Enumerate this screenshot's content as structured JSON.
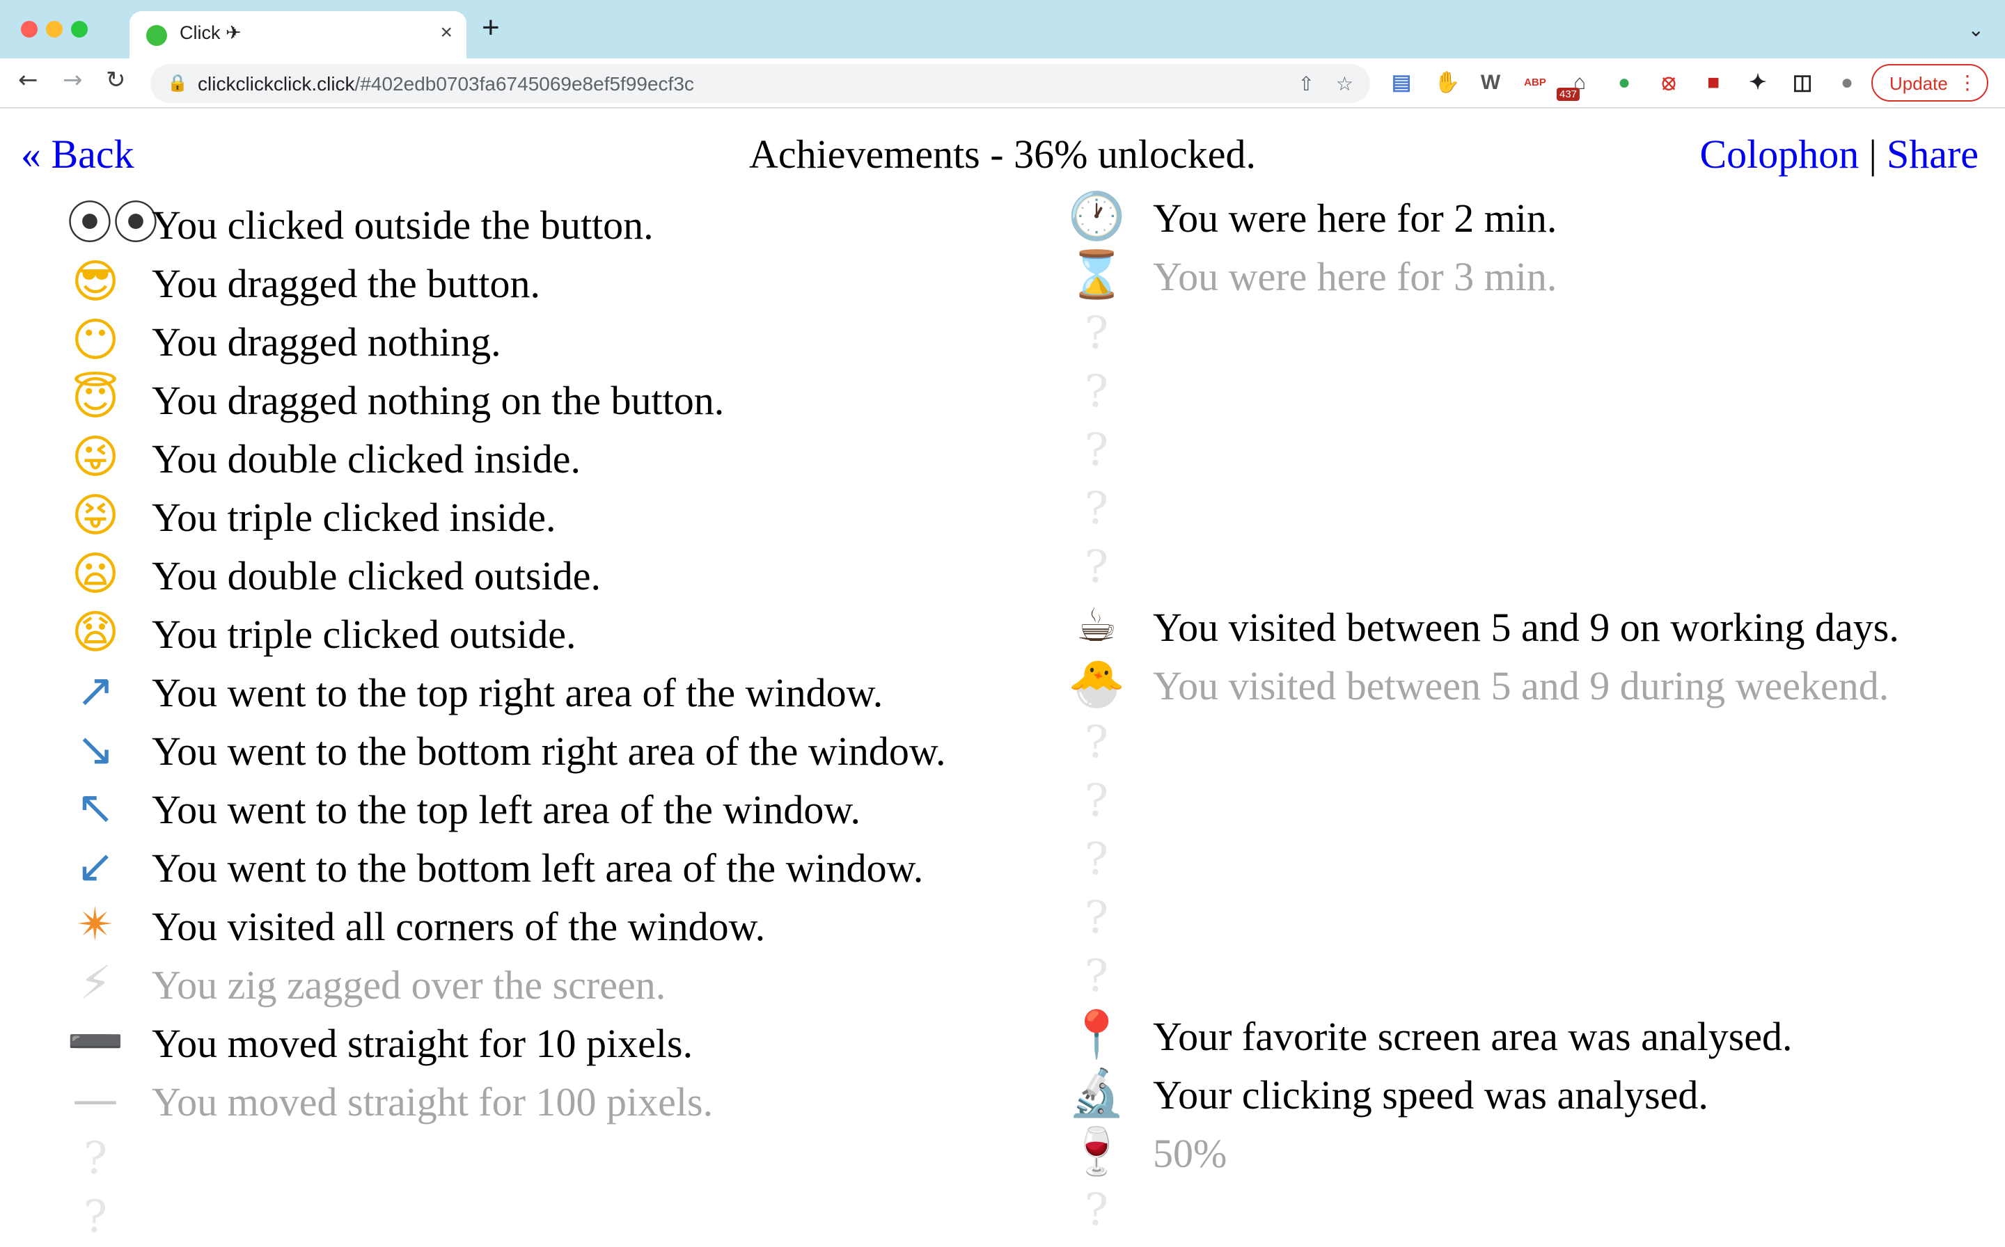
{
  "browser": {
    "tab_title": "Click ✈",
    "tab_close": "×",
    "new_tab": "+",
    "tab_menu": "⌄",
    "url_domain": "clickclickclick.click",
    "url_rest": "/#402edb0703fa6745069e8ef5f99ecf3c",
    "ext_badge": "437",
    "update_label": "Update",
    "update_menu": "⋮",
    "extensions": [
      {
        "name": "docs-ext-icon",
        "glyph": "▤",
        "color": "#4a7bd8"
      },
      {
        "name": "thumbs-up-ext-icon",
        "glyph": "✋",
        "color": "#e6a817"
      },
      {
        "name": "wallet-ext-icon",
        "glyph": "W",
        "color": "#555555"
      },
      {
        "name": "adblock-ext-icon",
        "glyph": "ABP",
        "color": "#d93025"
      },
      {
        "name": "museum-ext-icon",
        "glyph": "⌂",
        "color": "#444444"
      },
      {
        "name": "green-ext-icon",
        "glyph": "●",
        "color": "#34a853"
      },
      {
        "name": "block-ext-icon",
        "glyph": "⦻",
        "color": "#d93025"
      },
      {
        "name": "red-ext-icon",
        "glyph": "■",
        "color": "#c5221f"
      },
      {
        "name": "puzzle-ext-icon",
        "glyph": "✦",
        "color": "#202124"
      },
      {
        "name": "sidepanel-ext-icon",
        "glyph": "◫",
        "color": "#202124"
      },
      {
        "name": "profile-avatar-icon",
        "glyph": "●",
        "color": "#7d7d7d"
      }
    ]
  },
  "page": {
    "back_label": "« Back",
    "title": "Achievements - 36% unlocked.",
    "colophon_label": "Colophon",
    "separator": "|",
    "share_label": "Share"
  },
  "left_achievements": [
    {
      "icon": "eyeglasses-icon",
      "glyph": "⦿⦿",
      "color": "#333333",
      "label": "You clicked outside the button.",
      "unlocked": true
    },
    {
      "icon": "cool-face-icon",
      "glyph": "😎",
      "color": "#f4b400",
      "label": "You dragged the button.",
      "unlocked": true
    },
    {
      "icon": "no-mouth-face-icon",
      "glyph": "😶",
      "color": "#f4b400",
      "label": "You dragged nothing.",
      "unlocked": true
    },
    {
      "icon": "halo-face-icon",
      "glyph": "😇",
      "color": "#f4b400",
      "label": "You dragged nothing on the button.",
      "unlocked": true
    },
    {
      "icon": "winking-tongue-face-icon",
      "glyph": "😜",
      "color": "#f4b400",
      "label": "You double clicked inside.",
      "unlocked": true
    },
    {
      "icon": "squinting-tongue-face-icon",
      "glyph": "😝",
      "color": "#f4b400",
      "label": "You triple clicked inside.",
      "unlocked": true
    },
    {
      "icon": "frowning-face-icon",
      "glyph": "😦",
      "color": "#f4b400",
      "label": "You double clicked outside.",
      "unlocked": true
    },
    {
      "icon": "worried-face-icon",
      "glyph": "😧",
      "color": "#f4b400",
      "label": "You triple clicked outside.",
      "unlocked": true
    },
    {
      "icon": "arrow-up-right-icon",
      "glyph": "↗",
      "color": "#3b82c4",
      "label": "You went to the top right area of the window.",
      "unlocked": true
    },
    {
      "icon": "arrow-down-right-icon",
      "glyph": "↘",
      "color": "#3b82c4",
      "label": "You went to the bottom right area of the window.",
      "unlocked": true
    },
    {
      "icon": "arrow-up-left-icon",
      "glyph": "↖",
      "color": "#3b82c4",
      "label": "You went to the top left area of the window.",
      "unlocked": true
    },
    {
      "icon": "arrow-down-left-icon",
      "glyph": "↙",
      "color": "#3b82c4",
      "label": "You went to the bottom left area of the window.",
      "unlocked": true
    },
    {
      "icon": "eight-pointed-star-icon",
      "glyph": "✴",
      "color": "#f28c28",
      "label": "You visited all corners of the window.",
      "unlocked": true
    },
    {
      "icon": "lightning-icon",
      "glyph": "⚡",
      "color": "#d9d9d9",
      "label": "You zig zagged over the screen.",
      "unlocked": false
    },
    {
      "icon": "heavy-minus-icon",
      "glyph": "➖",
      "color": "#333333",
      "label": "You moved straight for 10 pixels.",
      "unlocked": true
    },
    {
      "icon": "horizontal-line-icon",
      "glyph": "—",
      "color": "#c8c8c8",
      "label": "You moved straight for 100 pixels.",
      "unlocked": false
    },
    {
      "icon": "question-mark-icon",
      "glyph": "?",
      "color": "#e6e6e6",
      "label": "",
      "unlocked": false
    },
    {
      "icon": "question-mark-icon",
      "glyph": "?",
      "color": "#e6e6e6",
      "label": "",
      "unlocked": false
    }
  ],
  "right_achievements": [
    {
      "icon": "clock-icon",
      "glyph": "🕐",
      "color": "#777777",
      "label": "You were here for 2 min.",
      "unlocked": true
    },
    {
      "icon": "hourglass-icon",
      "glyph": "⌛",
      "color": "#d9d2c4",
      "label": "You were here for 3 min.",
      "unlocked": false
    },
    {
      "icon": "question-mark-icon",
      "glyph": "?",
      "color": "#e6e6e6",
      "label": "",
      "unlocked": false
    },
    {
      "icon": "question-mark-icon",
      "glyph": "?",
      "color": "#e6e6e6",
      "label": "",
      "unlocked": false
    },
    {
      "icon": "question-mark-icon",
      "glyph": "?",
      "color": "#e6e6e6",
      "label": "",
      "unlocked": false
    },
    {
      "icon": "question-mark-icon",
      "glyph": "?",
      "color": "#e6e6e6",
      "label": "",
      "unlocked": false
    },
    {
      "icon": "question-mark-icon",
      "glyph": "?",
      "color": "#e6e6e6",
      "label": "",
      "unlocked": false
    },
    {
      "icon": "coffee-icon",
      "glyph": "☕",
      "color": "#4a3426",
      "label": "You visited between 5 and 9 on working days.",
      "unlocked": true
    },
    {
      "icon": "hatching-chick-icon",
      "glyph": "🐣",
      "color": "#e8dca8",
      "label": "You visited between 5 and 9 during weekend.",
      "unlocked": false
    },
    {
      "icon": "question-mark-icon",
      "glyph": "?",
      "color": "#e6e6e6",
      "label": "",
      "unlocked": false
    },
    {
      "icon": "question-mark-icon",
      "glyph": "?",
      "color": "#e6e6e6",
      "label": "",
      "unlocked": false
    },
    {
      "icon": "question-mark-icon",
      "glyph": "?",
      "color": "#e6e6e6",
      "label": "",
      "unlocked": false
    },
    {
      "icon": "question-mark-icon",
      "glyph": "?",
      "color": "#e6e6e6",
      "label": "",
      "unlocked": false
    },
    {
      "icon": "question-mark-icon",
      "glyph": "?",
      "color": "#e6e6e6",
      "label": "",
      "unlocked": false
    },
    {
      "icon": "round-pushpin-icon",
      "glyph": "📍",
      "color": "#d93025",
      "label": "Your favorite screen area was analysed.",
      "unlocked": true
    },
    {
      "icon": "microscope-icon",
      "glyph": "🔬",
      "color": "#666666",
      "label": "Your clicking speed was analysed.",
      "unlocked": true
    },
    {
      "icon": "wine-glass-icon",
      "glyph": "🍷",
      "color": "#d8a7a7",
      "label": "50%",
      "unlocked": false
    },
    {
      "icon": "question-mark-icon",
      "glyph": "?",
      "color": "#e6e6e6",
      "label": "",
      "unlocked": false
    }
  ]
}
